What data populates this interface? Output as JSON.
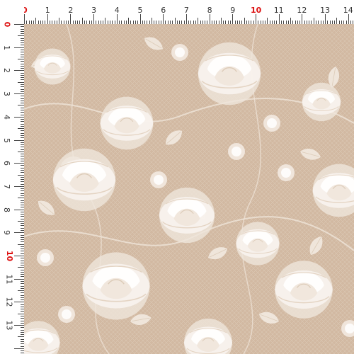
{
  "ruler": {
    "top_labels": [
      "0",
      "1",
      "2",
      "3",
      "4",
      "5",
      "6",
      "7",
      "8",
      "9",
      "10",
      "11",
      "12",
      "13",
      "14"
    ],
    "left_labels": [
      "0",
      "1",
      "2",
      "3",
      "4",
      "5",
      "6",
      "7",
      "8",
      "9",
      "10",
      "11",
      "12",
      "13"
    ],
    "highlight_color": "#d11111"
  },
  "fabric": {
    "pattern": "floral-lace",
    "base_color": "#d2b9a2",
    "flower_color": "#f7f1ea"
  }
}
